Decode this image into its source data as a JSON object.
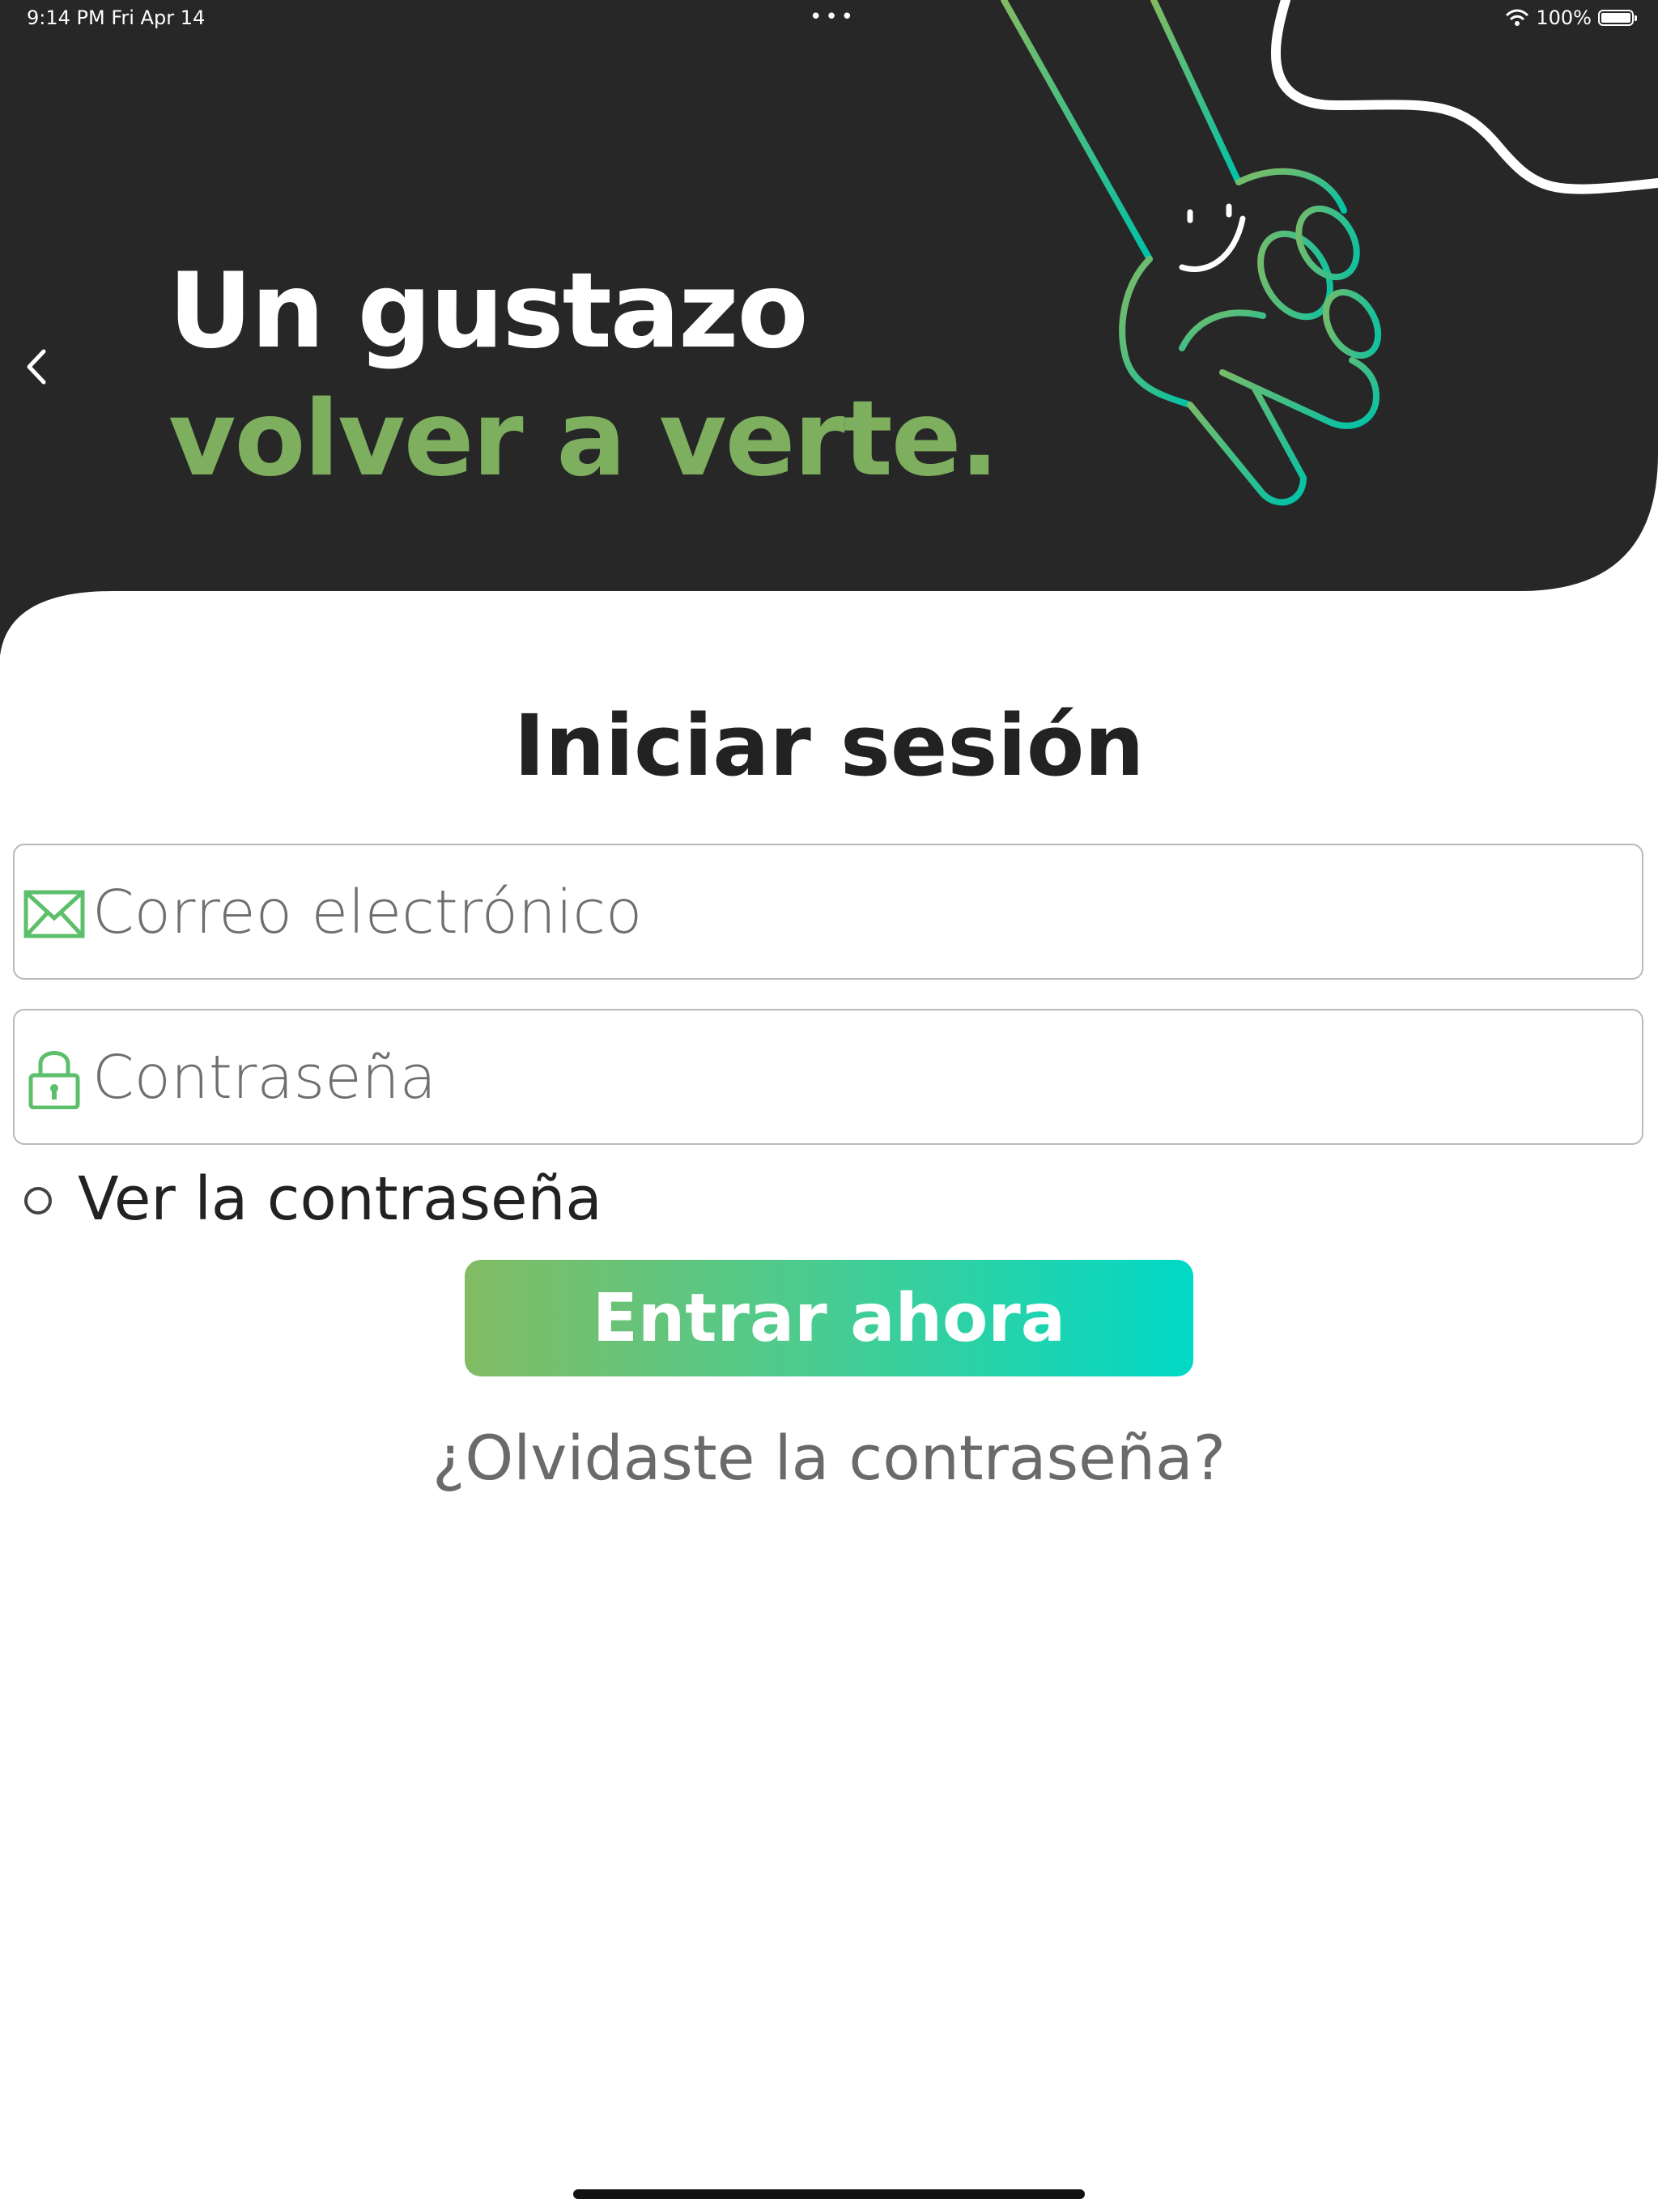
{
  "status_bar": {
    "time": "9:14 PM   Fri Apr 14",
    "dots": "•••",
    "battery": "100%",
    "battery_level": 1.0
  },
  "header": {
    "line1": "Un gustazo",
    "line2": "volver a verte.",
    "accent": "#7daf5f",
    "background": "#272727",
    "back_icon": "chevron-left-icon"
  },
  "form": {
    "title": "Iniciar sesión",
    "email": {
      "placeholder": "Correo electrónico",
      "icon": "envelope-icon"
    },
    "password": {
      "placeholder": "Contraseña",
      "icon": "lock-icon"
    },
    "show_password_label": "Ver la contraseña",
    "submit_label": "Entrar ahora",
    "forgot_label": "¿Olvidaste la contraseña?",
    "icon_color": "#5cbf6b"
  }
}
